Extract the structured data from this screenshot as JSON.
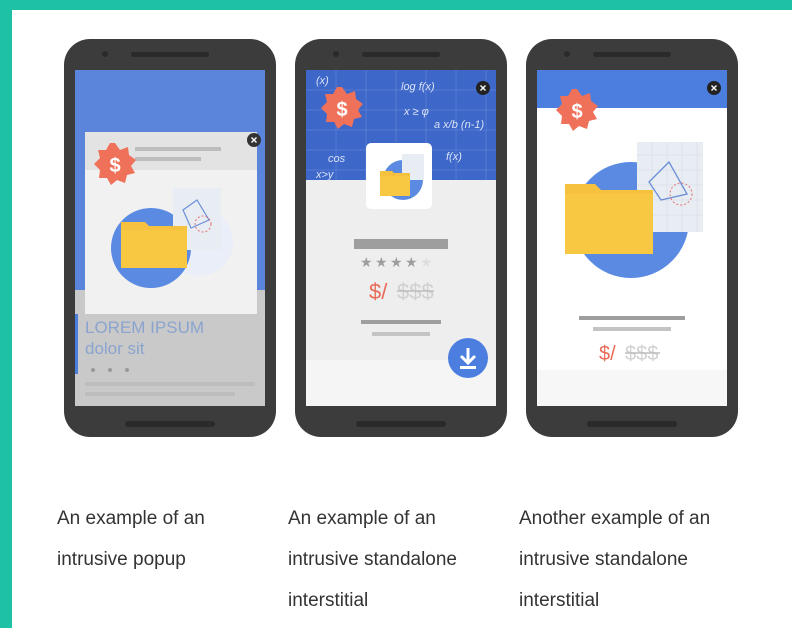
{
  "captions": [
    {
      "line1": "An example of an",
      "line2": "intrusive popup",
      "line3": ""
    },
    {
      "line1": "An example of an",
      "line2": "intrusive standalone",
      "line3": "interstitial"
    },
    {
      "line1": "Another example of an",
      "line2": "intrusive standalone",
      "line3": "interstitial"
    }
  ],
  "phone1": {
    "headline1": "LOREM IPSUM",
    "headline2": "dolor sit"
  },
  "phone2": {
    "price_currency": "$/",
    "price_strike": "$$$",
    "stars": 4
  },
  "phone3": {
    "price_currency": "$/",
    "price_strike": "$$$"
  },
  "colors": {
    "border": "#1ec1a4",
    "phone": "#3c3c3c",
    "blue": "#4c7ee0",
    "yellow": "#f9c843",
    "badge": "#f0715a",
    "accent_red": "#e96a58"
  }
}
